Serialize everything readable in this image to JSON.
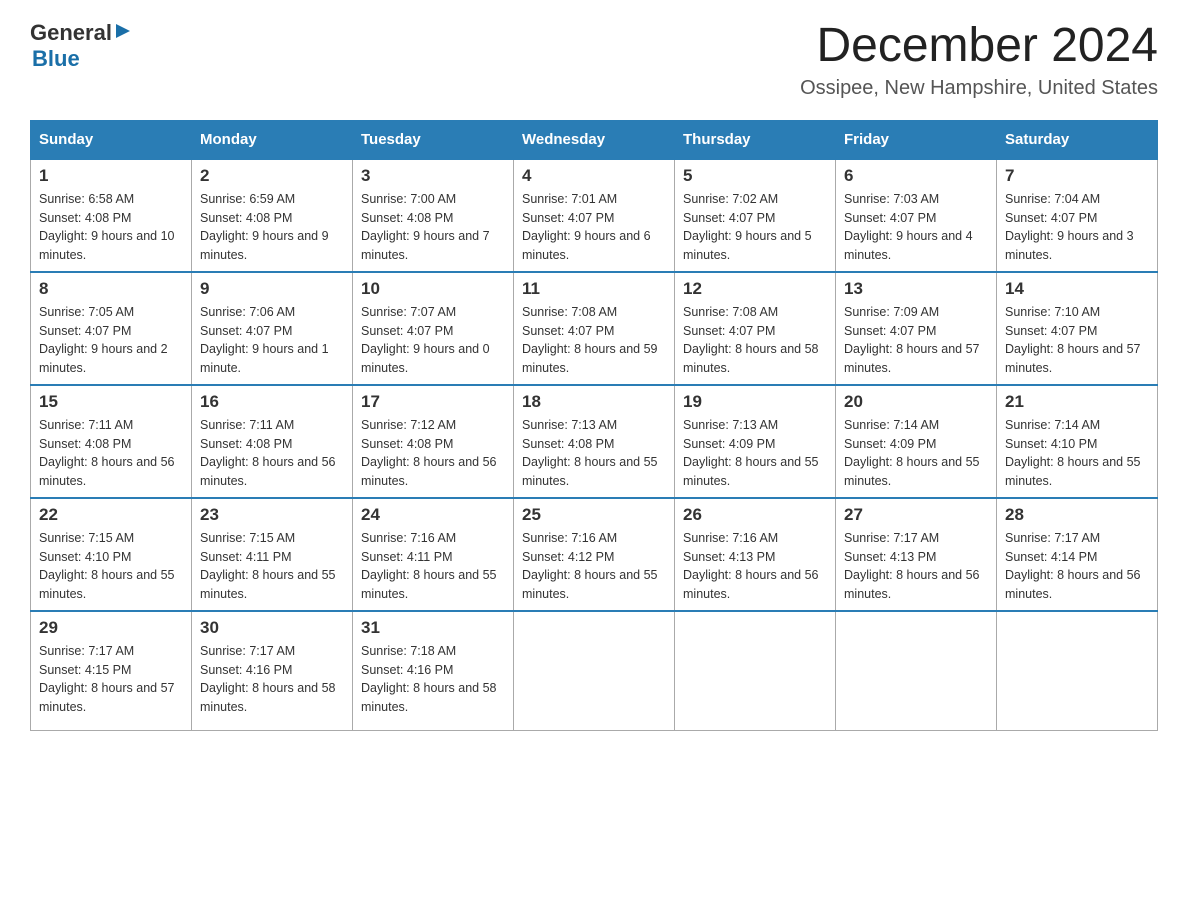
{
  "header": {
    "logo_general": "General",
    "logo_blue": "Blue",
    "title": "December 2024",
    "subtitle": "Ossipee, New Hampshire, United States"
  },
  "days_of_week": [
    "Sunday",
    "Monday",
    "Tuesday",
    "Wednesday",
    "Thursday",
    "Friday",
    "Saturday"
  ],
  "weeks": [
    [
      {
        "day": "1",
        "sunrise": "6:58 AM",
        "sunset": "4:08 PM",
        "daylight": "9 hours and 10 minutes."
      },
      {
        "day": "2",
        "sunrise": "6:59 AM",
        "sunset": "4:08 PM",
        "daylight": "9 hours and 9 minutes."
      },
      {
        "day": "3",
        "sunrise": "7:00 AM",
        "sunset": "4:08 PM",
        "daylight": "9 hours and 7 minutes."
      },
      {
        "day": "4",
        "sunrise": "7:01 AM",
        "sunset": "4:07 PM",
        "daylight": "9 hours and 6 minutes."
      },
      {
        "day": "5",
        "sunrise": "7:02 AM",
        "sunset": "4:07 PM",
        "daylight": "9 hours and 5 minutes."
      },
      {
        "day": "6",
        "sunrise": "7:03 AM",
        "sunset": "4:07 PM",
        "daylight": "9 hours and 4 minutes."
      },
      {
        "day": "7",
        "sunrise": "7:04 AM",
        "sunset": "4:07 PM",
        "daylight": "9 hours and 3 minutes."
      }
    ],
    [
      {
        "day": "8",
        "sunrise": "7:05 AM",
        "sunset": "4:07 PM",
        "daylight": "9 hours and 2 minutes."
      },
      {
        "day": "9",
        "sunrise": "7:06 AM",
        "sunset": "4:07 PM",
        "daylight": "9 hours and 1 minute."
      },
      {
        "day": "10",
        "sunrise": "7:07 AM",
        "sunset": "4:07 PM",
        "daylight": "9 hours and 0 minutes."
      },
      {
        "day": "11",
        "sunrise": "7:08 AM",
        "sunset": "4:07 PM",
        "daylight": "8 hours and 59 minutes."
      },
      {
        "day": "12",
        "sunrise": "7:08 AM",
        "sunset": "4:07 PM",
        "daylight": "8 hours and 58 minutes."
      },
      {
        "day": "13",
        "sunrise": "7:09 AM",
        "sunset": "4:07 PM",
        "daylight": "8 hours and 57 minutes."
      },
      {
        "day": "14",
        "sunrise": "7:10 AM",
        "sunset": "4:07 PM",
        "daylight": "8 hours and 57 minutes."
      }
    ],
    [
      {
        "day": "15",
        "sunrise": "7:11 AM",
        "sunset": "4:08 PM",
        "daylight": "8 hours and 56 minutes."
      },
      {
        "day": "16",
        "sunrise": "7:11 AM",
        "sunset": "4:08 PM",
        "daylight": "8 hours and 56 minutes."
      },
      {
        "day": "17",
        "sunrise": "7:12 AM",
        "sunset": "4:08 PM",
        "daylight": "8 hours and 56 minutes."
      },
      {
        "day": "18",
        "sunrise": "7:13 AM",
        "sunset": "4:08 PM",
        "daylight": "8 hours and 55 minutes."
      },
      {
        "day": "19",
        "sunrise": "7:13 AM",
        "sunset": "4:09 PM",
        "daylight": "8 hours and 55 minutes."
      },
      {
        "day": "20",
        "sunrise": "7:14 AM",
        "sunset": "4:09 PM",
        "daylight": "8 hours and 55 minutes."
      },
      {
        "day": "21",
        "sunrise": "7:14 AM",
        "sunset": "4:10 PM",
        "daylight": "8 hours and 55 minutes."
      }
    ],
    [
      {
        "day": "22",
        "sunrise": "7:15 AM",
        "sunset": "4:10 PM",
        "daylight": "8 hours and 55 minutes."
      },
      {
        "day": "23",
        "sunrise": "7:15 AM",
        "sunset": "4:11 PM",
        "daylight": "8 hours and 55 minutes."
      },
      {
        "day": "24",
        "sunrise": "7:16 AM",
        "sunset": "4:11 PM",
        "daylight": "8 hours and 55 minutes."
      },
      {
        "day": "25",
        "sunrise": "7:16 AM",
        "sunset": "4:12 PM",
        "daylight": "8 hours and 55 minutes."
      },
      {
        "day": "26",
        "sunrise": "7:16 AM",
        "sunset": "4:13 PM",
        "daylight": "8 hours and 56 minutes."
      },
      {
        "day": "27",
        "sunrise": "7:17 AM",
        "sunset": "4:13 PM",
        "daylight": "8 hours and 56 minutes."
      },
      {
        "day": "28",
        "sunrise": "7:17 AM",
        "sunset": "4:14 PM",
        "daylight": "8 hours and 56 minutes."
      }
    ],
    [
      {
        "day": "29",
        "sunrise": "7:17 AM",
        "sunset": "4:15 PM",
        "daylight": "8 hours and 57 minutes."
      },
      {
        "day": "30",
        "sunrise": "7:17 AM",
        "sunset": "4:16 PM",
        "daylight": "8 hours and 58 minutes."
      },
      {
        "day": "31",
        "sunrise": "7:18 AM",
        "sunset": "4:16 PM",
        "daylight": "8 hours and 58 minutes."
      },
      null,
      null,
      null,
      null
    ]
  ]
}
